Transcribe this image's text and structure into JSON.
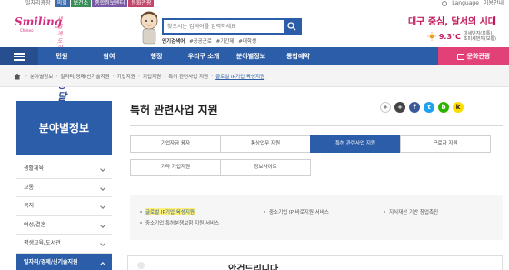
{
  "top_tabs": [
    "일자리광장",
    "의회",
    "보건소",
    "종합정보센터",
    "문화관광"
  ],
  "top_right": {
    "language": "Language",
    "login": "이용안내"
  },
  "logo": {
    "en": "Smiling",
    "en_sub": "Chilseo",
    "ko_tagline": "새롭게 도약하는",
    "ko_main": "희망달서"
  },
  "search": {
    "placeholder": "찾으시는 검색어를 입력하세요"
  },
  "popular": {
    "label": "인기검색어",
    "tags": [
      "#공공근로",
      "#기간제",
      "#대학생"
    ]
  },
  "slogan": "대구 중심, 달서의 시대",
  "weather": {
    "temp": "9.3°C",
    "air1": "미세먼지(보통)",
    "air2": "초미세먼지(보통)"
  },
  "nav": {
    "items": [
      "민원",
      "참여",
      "행정",
      "우리구 소개",
      "분야별정보",
      "통합예약"
    ],
    "culture": "문화관광"
  },
  "breadcrumb": [
    "분야별정보",
    "일자리/경제/신기술지원",
    "기업지원",
    "기업지원",
    "특허 관련사업 지원",
    "글로벌 IP기업 육성지원"
  ],
  "sidebar": {
    "title": "분야별정보",
    "items": [
      "생활체육",
      "교통",
      "복지",
      "여성/결혼",
      "평생교육/도서관",
      "일자리/경제/신기술지원"
    ]
  },
  "page_title": "특허 관련사업 지원",
  "share_buttons": [
    "+",
    "+",
    "f",
    "t",
    "b",
    "k"
  ],
  "tabs": {
    "row1": [
      "기업자금 융자",
      "통상업무 지원",
      "특허 관련사업 지원",
      "근로자 지원"
    ],
    "row2": [
      "기타 기업지원",
      "정보사이트"
    ]
  },
  "links": {
    "l1": "글로벌 IP기업 육성지원",
    "l2": "중소기업 IP 바로지원 서비스",
    "l3": "지식재산 기반 창업촉진",
    "l4": "중소기업 특허분쟁보험 지원 서비스"
  },
  "subhead": "안건드리니다",
  "colors": {
    "primary": "#2c5da8",
    "accent": "#e24177",
    "highlight": "#fff176"
  }
}
